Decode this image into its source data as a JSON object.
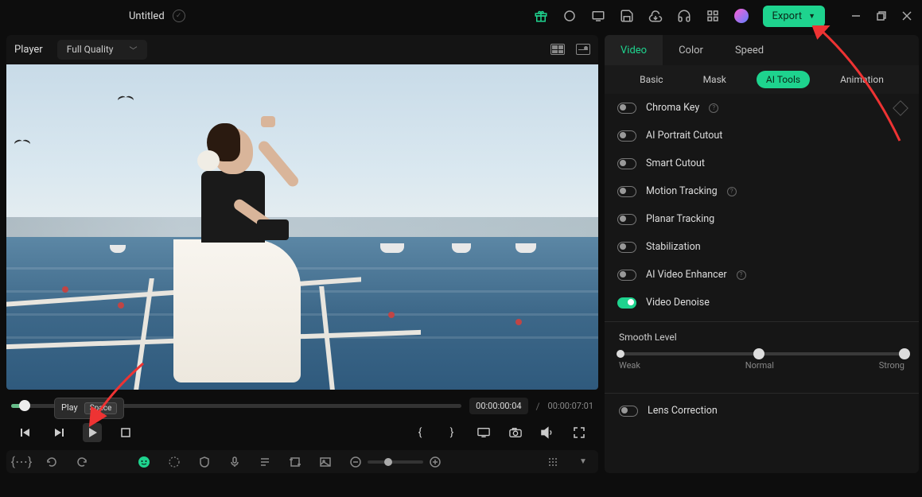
{
  "title": "Untitled",
  "export_label": "Export",
  "player": {
    "title": "Player",
    "quality": "Full Quality",
    "time_current": "00:00:00:04",
    "time_total": "00:00:07:01"
  },
  "tooltip": {
    "label": "Play",
    "key": "Space"
  },
  "tabs_main": {
    "video": "Video",
    "color": "Color",
    "speed": "Speed"
  },
  "tabs_sub": {
    "basic": "Basic",
    "mask": "Mask",
    "ai_tools": "AI Tools",
    "animation": "Animation"
  },
  "tools": [
    {
      "label": "Chroma Key",
      "on": false,
      "info": true,
      "shortcut": true
    },
    {
      "label": "AI Portrait Cutout",
      "on": false,
      "info": false
    },
    {
      "label": "Smart Cutout",
      "on": false,
      "info": false
    },
    {
      "label": "Motion Tracking",
      "on": false,
      "info": true
    },
    {
      "label": "Planar Tracking",
      "on": false,
      "info": false
    },
    {
      "label": "Stabilization",
      "on": false,
      "info": false
    },
    {
      "label": "AI Video Enhancer",
      "on": false,
      "info": true
    },
    {
      "label": "Video Denoise",
      "on": true,
      "info": false
    }
  ],
  "smooth": {
    "title": "Smooth Level",
    "weak": "Weak",
    "normal": "Normal",
    "strong": "Strong"
  },
  "lens": {
    "label": "Lens Correction"
  }
}
